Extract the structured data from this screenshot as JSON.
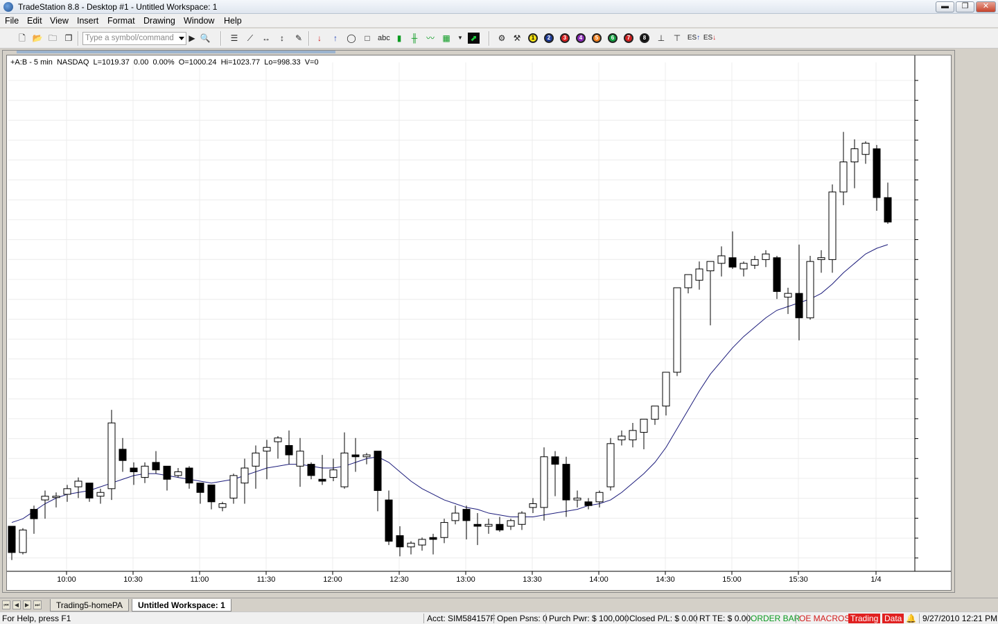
{
  "window": {
    "title": "TradeStation 8.8 - Desktop #1 - Untitled Workspace:  1",
    "minimize": "▬",
    "restore": "❐",
    "close": "✕"
  },
  "menu": [
    "File",
    "Edit",
    "View",
    "Insert",
    "Format",
    "Drawing",
    "Window",
    "Help"
  ],
  "toolbar": {
    "symbol_placeholder": "Type a symbol/command",
    "icons": [
      "new-icon",
      "open-icon",
      "folder-icon",
      "windows-icon",
      "symbol-lookup-icon",
      "bars-icon",
      "trendline-icon",
      "horizontal-icon",
      "vertical-icon",
      "pencil-icon",
      "sell-arrow-icon",
      "buy-arrow-icon",
      "ellipse-icon",
      "rectangle-icon",
      "text-icon",
      "candles-icon",
      "tick-icon",
      "line-icon",
      "indicator-icon",
      "chart-icon"
    ],
    "numbered_icons": [
      "1",
      "2",
      "3",
      "4",
      "5",
      "6",
      "7",
      "8"
    ],
    "numbered_colors": [
      "#f6e313",
      "#1f3c9a",
      "#d82020",
      "#8b2bb8",
      "#f08020",
      "#12a040",
      "#d02020",
      "#111111"
    ],
    "es_up": "ES",
    "es_down": "ES",
    "abc": "abc"
  },
  "chart_header": "+A:B - 5 min  NASDAQ  L=1019.37  0.00  0.00%  O=1000.24  Hi=1023.77  Lo=998.33  V=0",
  "chart_data": {
    "type": "candlestick",
    "xlabels": [
      "10:00",
      "10:30",
      "11:00",
      "11:30",
      "12:00",
      "12:30",
      "13:00",
      "13:30",
      "14:00",
      "14:30",
      "15:00",
      "15:30",
      "1/4"
    ],
    "ylim": [
      998.33,
      1023.77
    ],
    "candles": [
      [
        999.2,
        999.2,
        997.4,
        997.8
      ],
      [
        997.8,
        999.1,
        997.7,
        999.0
      ],
      [
        1000.1,
        1000.3,
        998.8,
        999.6
      ],
      [
        1000.6,
        1001.1,
        999.6,
        1000.8
      ],
      [
        1000.8,
        1001.0,
        1000.2,
        1000.8
      ],
      [
        1000.9,
        1001.4,
        1000.5,
        1001.2
      ],
      [
        1001.3,
        1001.8,
        1000.7,
        1001.6
      ],
      [
        1001.5,
        1001.5,
        1000.5,
        1000.7
      ],
      [
        1000.8,
        1001.2,
        1000.4,
        1001.0
      ],
      [
        1001.2,
        1005.4,
        1000.6,
        1004.7
      ],
      [
        1003.3,
        1003.9,
        1002.1,
        1002.7
      ],
      [
        1002.3,
        1002.6,
        1001.4,
        1002.1
      ],
      [
        1001.8,
        1002.6,
        1001.5,
        1002.4
      ],
      [
        1002.6,
        1003.2,
        1002.0,
        1002.2
      ],
      [
        1002.4,
        1002.4,
        1001.1,
        1001.7
      ],
      [
        1001.9,
        1002.3,
        1001.8,
        1002.1
      ],
      [
        1002.3,
        1002.4,
        1001.2,
        1001.5
      ],
      [
        1001.5,
        1001.5,
        1000.4,
        1001.0
      ],
      [
        1001.4,
        1001.4,
        1000.1,
        1000.5
      ],
      [
        1000.2,
        1000.5,
        1000.0,
        1000.4
      ],
      [
        1000.7,
        1002.0,
        1000.4,
        1001.9
      ],
      [
        1001.5,
        1002.8,
        1000.4,
        1002.3
      ],
      [
        1002.4,
        1003.5,
        1001.2,
        1003.1
      ],
      [
        1003.2,
        1003.8,
        1001.7,
        1003.4
      ],
      [
        1003.7,
        1004.0,
        1002.8,
        1003.9
      ],
      [
        1003.5,
        1004.3,
        1002.5,
        1003.0
      ],
      [
        1002.4,
        1003.9,
        1001.3,
        1003.2
      ],
      [
        1002.5,
        1002.6,
        1001.7,
        1001.9
      ],
      [
        1001.7,
        1003.0,
        1001.4,
        1001.6
      ],
      [
        1001.8,
        1002.8,
        1001.6,
        1002.2
      ],
      [
        1001.3,
        1004.2,
        1001.2,
        1003.1
      ],
      [
        1003.0,
        1003.9,
        1002.1,
        1002.9
      ],
      [
        1002.9,
        1003.1,
        1002.5,
        1003.0
      ],
      [
        1003.2,
        1003.2,
        1000.0,
        1001.1
      ],
      [
        1000.6,
        1001.1,
        998.2,
        998.4
      ],
      [
        998.7,
        999.2,
        997.6,
        998.1
      ],
      [
        998.1,
        998.4,
        997.7,
        998.3
      ],
      [
        998.2,
        998.6,
        997.9,
        998.5
      ],
      [
        998.6,
        998.8,
        997.7,
        998.5
      ],
      [
        998.6,
        999.6,
        998.3,
        999.4
      ],
      [
        999.5,
        1000.3,
        999.3,
        999.9
      ],
      [
        1000.1,
        1000.3,
        998.5,
        999.5
      ],
      [
        999.3,
        999.9,
        998.2,
        999.2
      ],
      [
        999.2,
        999.6,
        998.8,
        999.3
      ],
      [
        999.3,
        999.7,
        998.9,
        999.0
      ],
      [
        999.2,
        999.6,
        999.0,
        999.5
      ],
      [
        999.3,
        1000.0,
        999.0,
        999.9
      ],
      [
        1000.2,
        1000.7,
        999.9,
        1000.4
      ],
      [
        1000.2,
        1003.4,
        999.5,
        1002.9
      ],
      [
        1002.9,
        1003.2,
        1000.8,
        1002.5
      ],
      [
        1002.5,
        1002.9,
        999.7,
        1000.6
      ],
      [
        1000.6,
        1001.1,
        1000.2,
        1000.7
      ],
      [
        1000.5,
        1000.7,
        1000.1,
        1000.3
      ],
      [
        1000.5,
        1001.1,
        1000.2,
        1001.0
      ],
      [
        1001.3,
        1003.9,
        1001.1,
        1003.6
      ],
      [
        1003.8,
        1004.3,
        1003.5,
        1004.0
      ],
      [
        1003.8,
        1004.7,
        1003.4,
        1004.3
      ],
      [
        1004.2,
        1004.7,
        1003.3,
        1004.9
      ],
      [
        1004.9,
        1005.5,
        1004.6,
        1005.6
      ],
      [
        1005.6,
        1007.2,
        1005.1,
        1007.4
      ],
      [
        1007.4,
        1011.8,
        1007.2,
        1011.9
      ],
      [
        1011.9,
        1012.6,
        1011.6,
        1012.6
      ],
      [
        1012.3,
        1013.3,
        1011.8,
        1012.9
      ],
      [
        1012.8,
        1013.3,
        1009.9,
        1013.3
      ],
      [
        1013.2,
        1014.1,
        1012.5,
        1013.6
      ],
      [
        1013.5,
        1014.9,
        1012.9,
        1013.0
      ],
      [
        1012.9,
        1013.3,
        1012.5,
        1013.2
      ],
      [
        1013.1,
        1013.6,
        1012.9,
        1013.4
      ],
      [
        1013.4,
        1013.9,
        1013.0,
        1013.7
      ],
      [
        1013.5,
        1013.6,
        1011.3,
        1011.7
      ],
      [
        1011.4,
        1011.9,
        1010.5,
        1011.6
      ],
      [
        1011.6,
        1014.2,
        1009.1,
        1010.3
      ],
      [
        1010.3,
        1013.6,
        1010.2,
        1013.3
      ],
      [
        1013.4,
        1013.9,
        1012.7,
        1013.5
      ],
      [
        1013.4,
        1017.4,
        1012.7,
        1017.0
      ],
      [
        1017.0,
        1020.2,
        1016.3,
        1018.6
      ],
      [
        1018.6,
        1019.8,
        1017.2,
        1019.3
      ],
      [
        1019.0,
        1019.7,
        1018.5,
        1019.6
      ],
      [
        1019.3,
        1019.5,
        1016.0,
        1016.7
      ],
      [
        1016.7,
        1017.5,
        1015.3,
        1015.4
      ]
    ],
    "ma": [
      999.4,
      999.6,
      1000.0,
      1000.4,
      1000.7,
      1000.9,
      1001.0,
      1001.1,
      1001.3,
      1001.5,
      1001.7,
      1001.9,
      1002.0,
      1002.0,
      1001.9,
      1001.8,
      1001.7,
      1001.6,
      1001.5,
      1001.6,
      1001.7,
      1001.9,
      1002.1,
      1002.3,
      1002.4,
      1002.5,
      1002.5,
      1002.4,
      1002.3,
      1002.3,
      1002.4,
      1002.6,
      1002.8,
      1002.9,
      1002.6,
      1002.1,
      1001.6,
      1001.2,
      1000.9,
      1000.6,
      1000.4,
      1000.2,
      1000.1,
      999.9,
      999.8,
      999.7,
      999.7,
      999.7,
      999.8,
      999.9,
      1000.0,
      1000.1,
      1000.3,
      1000.4,
      1000.6,
      1001.0,
      1001.5,
      1002.0,
      1002.6,
      1003.4,
      1004.4,
      1005.4,
      1006.4,
      1007.3,
      1008.0,
      1008.7,
      1009.3,
      1009.8,
      1010.3,
      1010.7,
      1010.9,
      1011.1,
      1011.3,
      1011.6,
      1012.1,
      1012.7,
      1013.2,
      1013.7,
      1014.0,
      1014.2
    ]
  },
  "tabs": {
    "nav": [
      "⏮",
      "◀",
      "▶",
      "⏭"
    ],
    "items": [
      "Trading5-homePA",
      "Untitled Workspace:  1"
    ]
  },
  "status": {
    "help": "For Help, press F1",
    "acct": "Acct: SIM584157F",
    "open": "Open Psns: 0",
    "purch": "Purch Pwr: $ 100,000",
    "closed": "Closed P/L: $ 0.00",
    "rtte": "RT TE: $ 0.00",
    "orderbar": "ORDER BAR",
    "oemacros": "OE MACROS",
    "trading": "Trading",
    "data": "Data",
    "datetime": "9/27/2010 12:21 PM"
  }
}
